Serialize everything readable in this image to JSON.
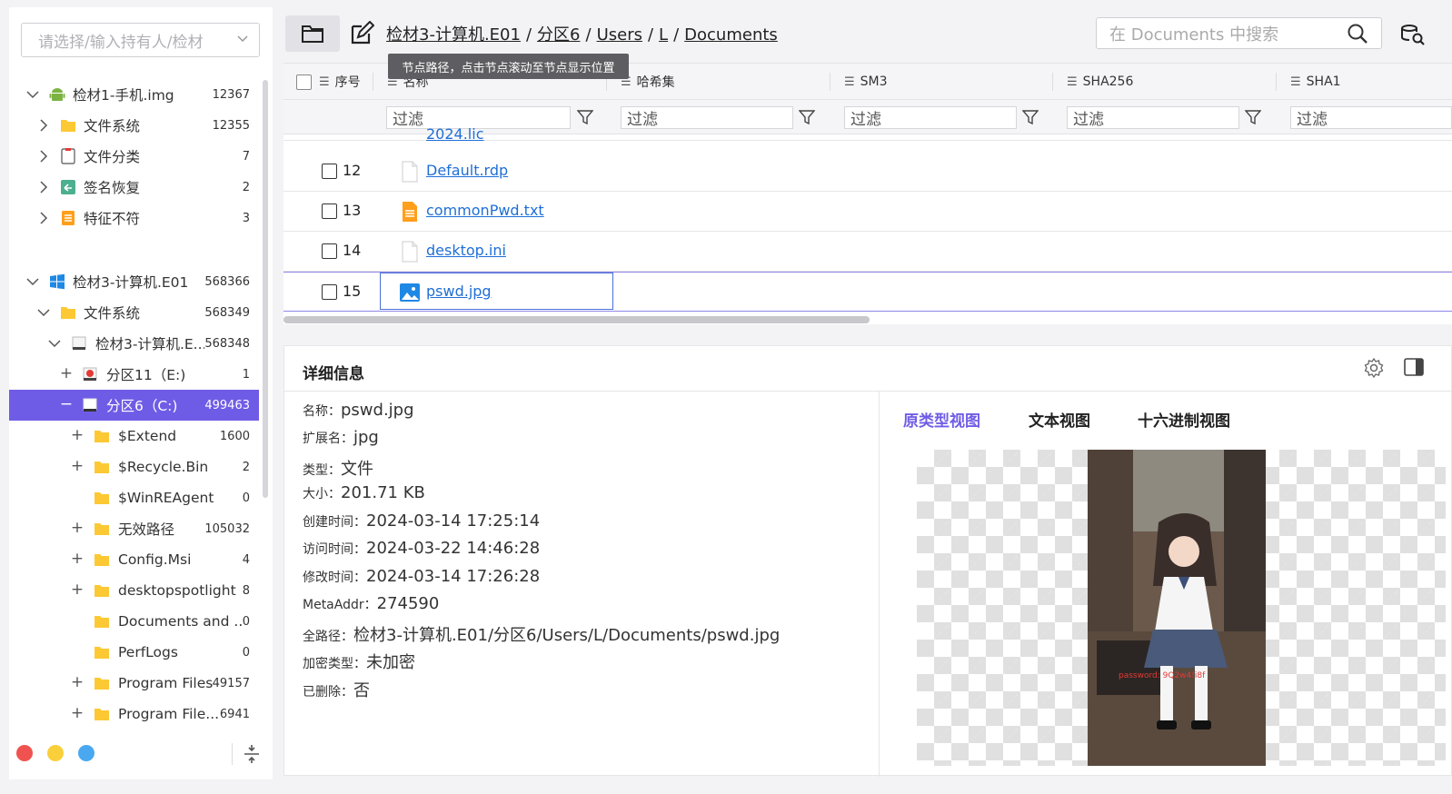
{
  "sidebar": {
    "owner_placeholder": "请选择/输入持有人/检材",
    "tree": [
      {
        "label": "检材1-手机.img",
        "count": "12367"
      },
      {
        "label": "文件系统",
        "count": "12355"
      },
      {
        "label": "文件分类",
        "count": "7"
      },
      {
        "label": "签名恢复",
        "count": "2"
      },
      {
        "label": "特征不符",
        "count": "3"
      },
      {
        "label": "检材3-计算机.E01",
        "count": "568366"
      },
      {
        "label": "文件系统",
        "count": "568349"
      },
      {
        "label": "检材3-计算机.E...",
        "count": "568348"
      },
      {
        "label": "分区11（E:)",
        "count": "1"
      },
      {
        "label": "分区6（C:)",
        "count": "499463"
      },
      {
        "label": "$Extend",
        "count": "1600"
      },
      {
        "label": "$Recycle.Bin",
        "count": "2"
      },
      {
        "label": "$WinREAgent",
        "count": "0"
      },
      {
        "label": "无效路径",
        "count": "105032"
      },
      {
        "label": "Config.Msi",
        "count": "4"
      },
      {
        "label": "desktopspotlight",
        "count": "8"
      },
      {
        "label": "Documents and ...",
        "count": "0"
      },
      {
        "label": "PerfLogs",
        "count": "0"
      },
      {
        "label": "Program Files",
        "count": "49157"
      },
      {
        "label": "Program File...",
        "count": "6941"
      }
    ]
  },
  "toolbar": {
    "breadcrumb": [
      "检材3-计算机.E01",
      "分区6",
      "Users",
      "L",
      "Documents"
    ],
    "tooltip": "节点路径，点击节点滚动至节点显示位置",
    "search_placeholder": "在 Documents 中搜索"
  },
  "table": {
    "columns": [
      "序号",
      "名称",
      "哈希集",
      "SM3",
      "SHA256",
      "SHA1"
    ],
    "filter_placeholder": "过滤",
    "partial_row": {
      "name": "2024.lic"
    },
    "rows": [
      {
        "num": "12",
        "name": "Default.rdp",
        "icon": "blank-file-icon"
      },
      {
        "num": "13",
        "name": "commonPwd.txt",
        "icon": "text-file-icon"
      },
      {
        "num": "14",
        "name": "desktop.ini",
        "icon": "blank-file-icon"
      },
      {
        "num": "15",
        "name": "pswd.jpg",
        "icon": "image-file-icon"
      }
    ]
  },
  "details": {
    "title": "详细信息",
    "props": [
      {
        "k": "名称：",
        "v": "pswd.jpg"
      },
      {
        "k": "扩展名：",
        "v": "jpg"
      },
      {
        "k": "类型：",
        "v": "文件"
      },
      {
        "k": "大小：",
        "v": "201.71 KB"
      },
      {
        "k": "创建时间：",
        "v": "2024-03-14 17:25:14"
      },
      {
        "k": "访问时间：",
        "v": "2024-03-22 14:46:28"
      },
      {
        "k": "修改时间：",
        "v": "2024-03-14 17:26:28"
      },
      {
        "k": "MetaAddr：",
        "v": "274590"
      },
      {
        "k": "全路径：",
        "v": "检材3-计算机.E01/分区6/Users/L/Documents/pswd.jpg"
      },
      {
        "k": "加密类型：",
        "v": "未加密"
      },
      {
        "k": "已删除：",
        "v": "否"
      }
    ],
    "view_tabs": [
      "原类型视图",
      "文本视图",
      "十六进制视图"
    ],
    "image_overlay_text": "password: 9Q2w4!i8f"
  },
  "colors": {
    "accent": "#6f5ce6",
    "link": "#1f6fd6",
    "dot_red": "#f0534f",
    "dot_yellow": "#f9cf3a",
    "dot_blue": "#4aa8f0"
  }
}
